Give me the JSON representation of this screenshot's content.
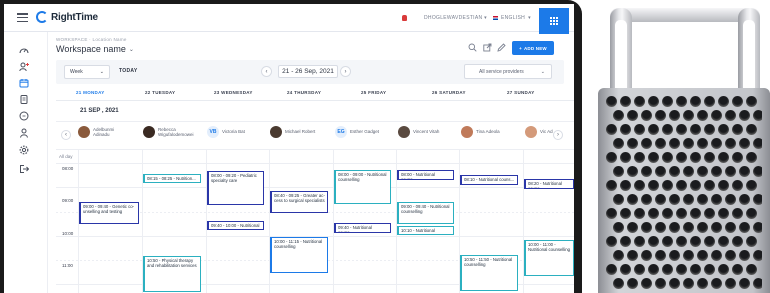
{
  "app": {
    "brand": "RightTime"
  },
  "header": {
    "user": "DHOGLEWAVDESTIAN",
    "language": "ENGLISH"
  },
  "workspace": {
    "crumb": "WORKSPACE · Location Name",
    "title": "Workspace name",
    "add_label": "ADD NEW"
  },
  "controls": {
    "view": "Week",
    "today": "TODAY",
    "date_range": "21 - 26 Sep, 2021",
    "providers_select": "All service providers"
  },
  "days": [
    "21 MONDAY",
    "22 TUESDAY",
    "23 WEDNESDAY",
    "24 THURSDAY",
    "25 FRIDAY",
    "26 SATURDAY",
    "27 SUNDAY"
  ],
  "date_label": "21 SEP , 2021",
  "providers": [
    {
      "name": "Adelbunmi Adinadu",
      "initials": ""
    },
    {
      "name": "Rebecca Wigufalodemowei",
      "initials": ""
    },
    {
      "name": "Victoria Bat",
      "initials": "VB"
    },
    {
      "name": "Michael Robert",
      "initials": ""
    },
    {
      "name": "Esther Gadget",
      "initials": "EG"
    },
    {
      "name": "Vincent Vitah",
      "initials": ""
    },
    {
      "name": "Tina Adeola",
      "initials": ""
    },
    {
      "name": "Vic Ad",
      "initials": ""
    }
  ],
  "grid": {
    "allday": "All day",
    "times": [
      "08:00",
      "09:00",
      "10:00",
      "11:00"
    ]
  },
  "events": [
    {
      "text": "08:15 - 08:25 - Nutrition..."
    },
    {
      "text": "09:00 - 09:40 - Genetic co-unselling and testing"
    },
    {
      "text": "10:50 - Physical therapy and rehabilitation services"
    },
    {
      "text": "08:00 - 09:20 - Pediatric specialty care"
    },
    {
      "text": "09:40 - 10:00 - Nutritional"
    },
    {
      "text": "08:40 - 09:25 - Greater ac-cess to surgical specialists"
    },
    {
      "text": "10:00 - 11:15 - Nutritional counselling"
    },
    {
      "text": "08:00 - 09:00 - Nutritional counselling"
    },
    {
      "text": "09:40 - Nutritional couns..."
    },
    {
      "text": "08:00 - Nutritional couns..."
    },
    {
      "text": "09:00 - 09:40 - Nutritional counselling"
    },
    {
      "text": "10:10 - Nutritional couns..."
    },
    {
      "text": "08:10 - Nutritional couns..."
    },
    {
      "text": "10:50 - 11:50 - Nutritional counselling"
    },
    {
      "text": "08:20 - Nutritional couns..."
    },
    {
      "text": "10:00 - 11:00 - Nutritional counselling"
    }
  ]
}
